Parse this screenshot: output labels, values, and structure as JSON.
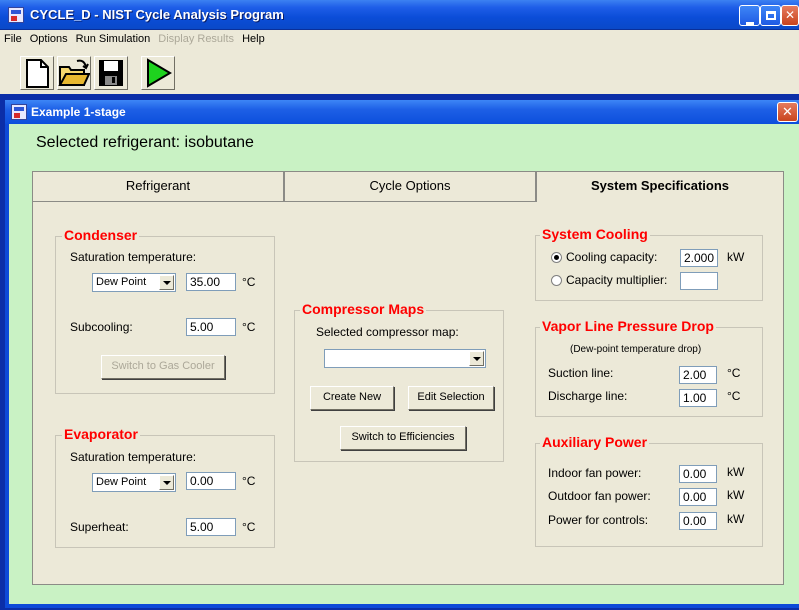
{
  "window": {
    "title": "CYCLE_D - NIST Cycle Analysis Program"
  },
  "menu": [
    {
      "label": "File",
      "enabled": true
    },
    {
      "label": "Options",
      "enabled": true
    },
    {
      "label": "Run Simulation",
      "enabled": true
    },
    {
      "label": "Display Results",
      "enabled": false
    },
    {
      "label": "Help",
      "enabled": true
    }
  ],
  "toolbar": {
    "icons": [
      "new-document-icon",
      "open-folder-icon",
      "save-disk-icon",
      "run-play-icon"
    ]
  },
  "child_window": {
    "title": "Example 1-stage"
  },
  "selected_refrigerant": {
    "text": "Selected refrigerant:  isobutane"
  },
  "tabs": [
    {
      "label": "Refrigerant",
      "active": false
    },
    {
      "label": "Cycle Options",
      "active": false
    },
    {
      "label": "System Specifications",
      "active": true
    }
  ],
  "condenser": {
    "title": "Condenser",
    "sat_temp_label": "Saturation temperature:",
    "sat_point": "Dew Point",
    "sat_temp_value": "35.00",
    "sat_temp_unit": "°C",
    "subcooling_label": "Subcooling:",
    "subcooling_value": "5.00",
    "subcooling_unit": "°C",
    "switch_button": "Switch to Gas Cooler"
  },
  "evaporator": {
    "title": "Evaporator",
    "sat_temp_label": "Saturation temperature:",
    "sat_point": "Dew Point",
    "sat_temp_value": "0.00",
    "sat_temp_unit": "°C",
    "superheat_label": "Superheat:",
    "superheat_value": "5.00",
    "superheat_unit": "°C"
  },
  "compressor": {
    "title": "Compressor Maps",
    "selected_label": "Selected compressor map:",
    "selected_value": "",
    "create_button": "Create New",
    "edit_button": "Edit Selection",
    "switch_button": "Switch to Efficiencies"
  },
  "system_cooling": {
    "title": "System Cooling",
    "cooling_capacity_label": "Cooling capacity:",
    "cooling_capacity_value": "2.000",
    "cooling_capacity_unit": "kW",
    "capacity_multiplier_label": "Capacity multiplier:",
    "capacity_multiplier_value": "",
    "selected_option": "cooling_capacity"
  },
  "vapor_line": {
    "title": "Vapor Line Pressure Drop",
    "note": "(Dew-point temperature drop)",
    "suction_label": "Suction line:",
    "suction_value": "2.00",
    "suction_unit": "°C",
    "discharge_label": "Discharge line:",
    "discharge_value": "1.00",
    "discharge_unit": "°C"
  },
  "auxiliary_power": {
    "title": "Auxiliary Power",
    "indoor_label": "Indoor fan power:",
    "indoor_value": "0.00",
    "indoor_unit": "kW",
    "outdoor_label": "Outdoor fan power:",
    "outdoor_value": "0.00",
    "outdoor_unit": "kW",
    "controls_label": "Power for controls:",
    "controls_value": "0.00",
    "controls_unit": "kW"
  },
  "colors": {
    "title_bar": "#0b4dd8",
    "form_background": "#c9f2c4",
    "group_title": "#ff0000",
    "mdi_background": "#0b2ea8"
  }
}
